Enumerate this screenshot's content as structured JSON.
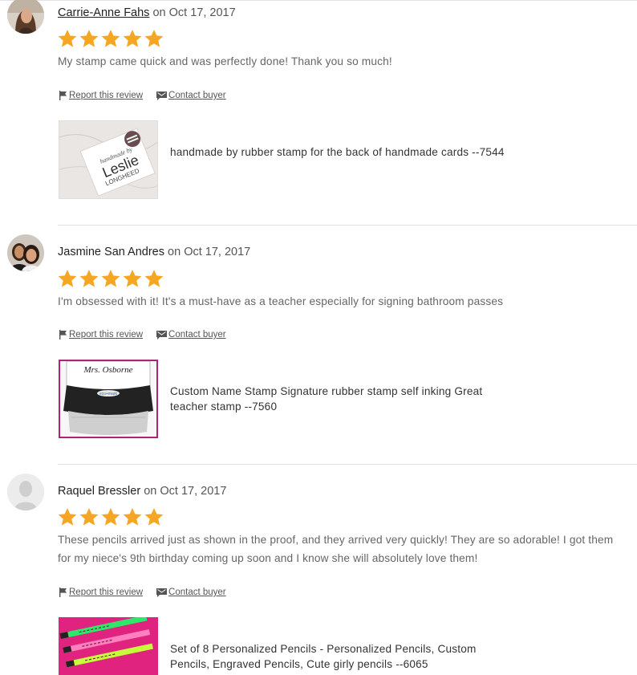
{
  "colors": {
    "star": "#f5a623",
    "divider": "#e1e1e1",
    "thumb_border_2": "#b0217a",
    "thumb_bg_3": "#e0237e"
  },
  "actions": {
    "report": "Report this review",
    "contact": "Contact buyer"
  },
  "reviews": [
    {
      "name": "Carrie-Anne Fahs",
      "date_prefix": "on",
      "date": "Oct 17, 2017",
      "rating": 5,
      "text": "My stamp came quick and was perfectly done! Thank you so much!",
      "product_title": "handmade by rubber stamp for the back of handmade cards --7544",
      "thumb_text": {
        "line1": "handmade by",
        "line2": "Leslie",
        "line3": "LONGHEED"
      }
    },
    {
      "name": "Jasmine San Andres",
      "date_prefix": "on",
      "date": "Oct 17, 2017",
      "rating": 5,
      "text": "I'm obsessed with it! It's a must-have as a teacher especially for signing bathroom passes",
      "product_title": "Custom Name Stamp Signature rubber stamp self inking Great teacher stamp --7560",
      "thumb_text": {
        "line1": "Mrs. Osborne",
        "line2": "eco+mark"
      }
    },
    {
      "name": "Raquel Bressler",
      "date_prefix": "on",
      "date": "Oct 17, 2017",
      "rating": 5,
      "text": "These pencils arrived just as shown in the proof, and they arrived very quickly! They are so adorable! I got them for my niece's 9th birthday coming up soon and I know she will absolutely love them!",
      "product_title": "Set of 8 Personalized Pencils - Personalized Pencils, Custom Pencils, Engraved Pencils, Cute girly pencils --6065"
    }
  ]
}
